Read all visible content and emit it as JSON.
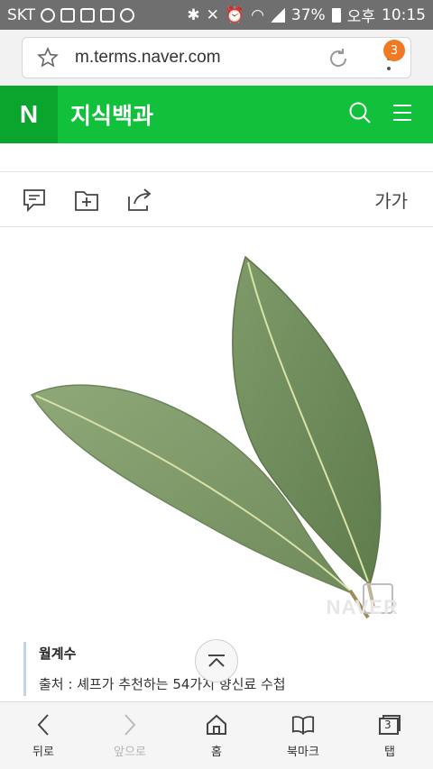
{
  "status_bar": {
    "carrier": "SKT",
    "battery": "37%",
    "ampm": "오후",
    "time": "10:15"
  },
  "browser": {
    "url": "m.terms.naver.com",
    "tab_badge": "3"
  },
  "header": {
    "logo": "N",
    "title": "지식백과"
  },
  "toolbar": {
    "font_size_label": "가가"
  },
  "image": {
    "watermark": "NAVER"
  },
  "caption": {
    "title": "월계수",
    "source": "출처 : 셰프가 추천하는 54가지 향신료 수첩"
  },
  "bottom_nav": {
    "back": "뒤로",
    "forward": "앞으로",
    "home": "홈",
    "bookmark": "북마크",
    "tabs": "탭",
    "tabs_count": "3"
  }
}
